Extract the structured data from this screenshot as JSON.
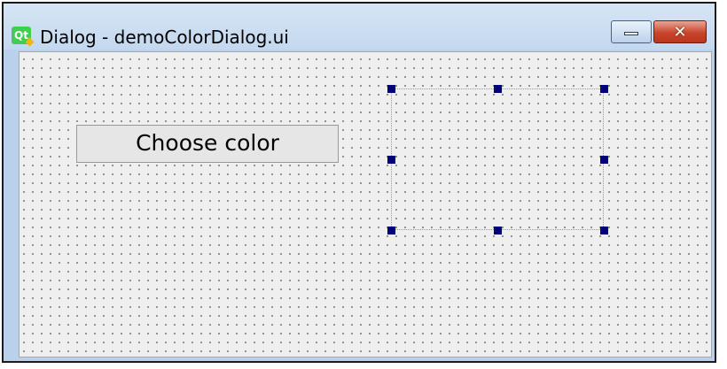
{
  "window": {
    "title": "Dialog - demoColorDialog.ui",
    "app_icon": "qt-logo-icon",
    "minimize_icon": "minimize-icon",
    "close_icon": "close-icon",
    "close_glyph": "✕"
  },
  "form": {
    "choose_button_label": "Choose color",
    "selection_handles": [
      "top-left",
      "top-center",
      "top-right",
      "middle-left",
      "middle-right",
      "bottom-left",
      "bottom-center",
      "bottom-right"
    ]
  },
  "colors": {
    "handle": "#000080",
    "canvas": "#efefef",
    "titlebar": "#c4d8ee",
    "close_button": "#c9442b"
  }
}
